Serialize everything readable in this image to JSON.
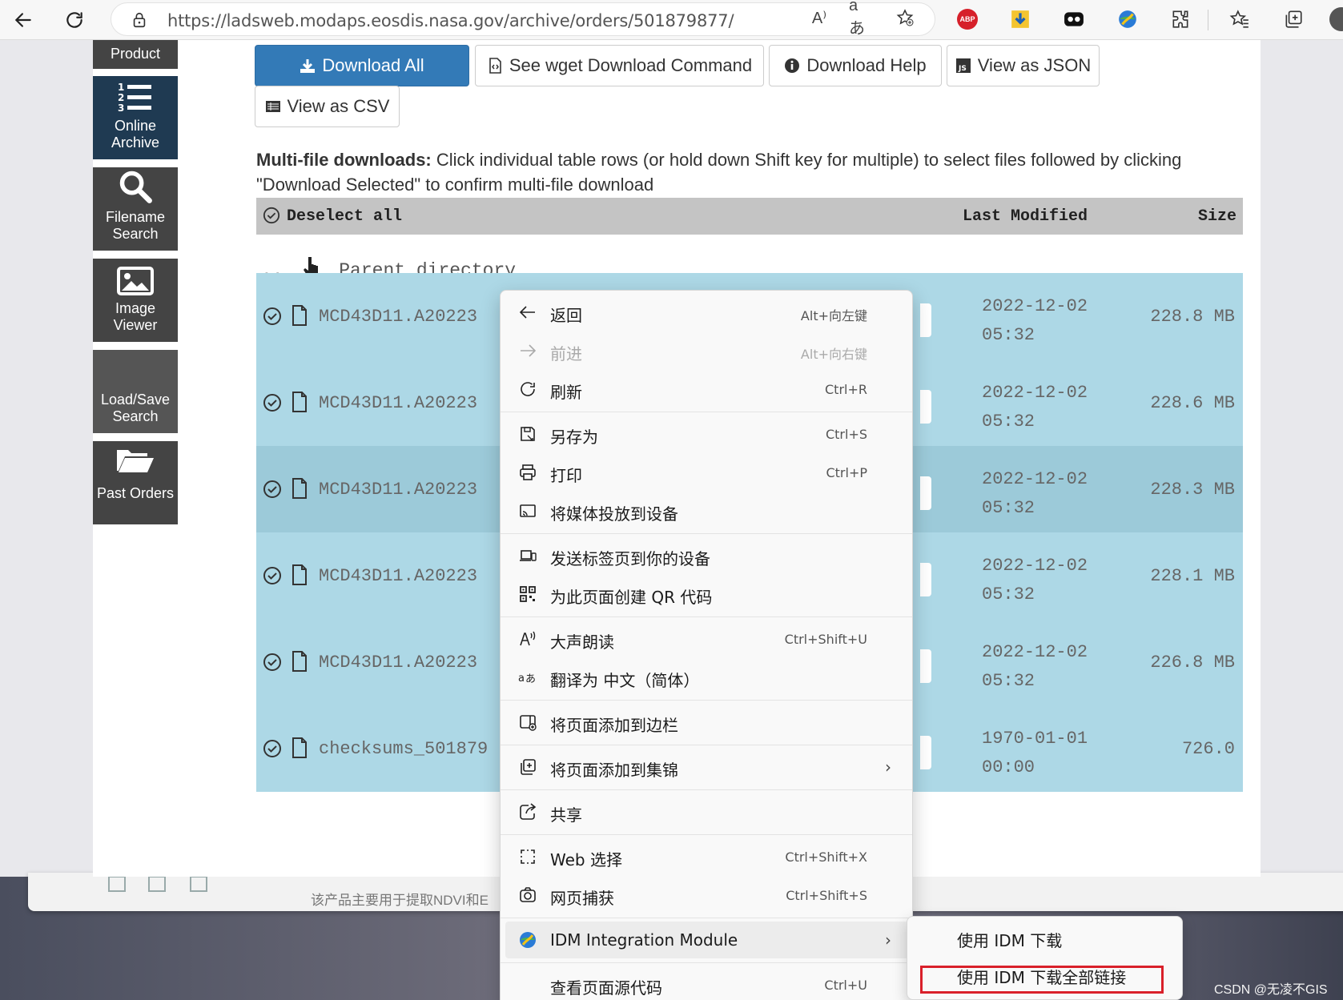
{
  "browser": {
    "url": "https://ladsweb.modaps.eosdis.nasa.gov/archive/orders/501879877/",
    "read_aloud_glyph": "A⁾",
    "translate_glyph": "aあ",
    "abp_label": "ABP"
  },
  "sidebar": {
    "items": [
      {
        "label_1": "Product",
        "label_2": ""
      },
      {
        "label_1": "Online",
        "label_2": "Archive"
      },
      {
        "label_1": "Filename",
        "label_2": "Search"
      },
      {
        "label_1": "Image",
        "label_2": "Viewer"
      },
      {
        "label_1": "Load/Save",
        "label_2": "Search"
      },
      {
        "label_1": "Past Orders",
        "label_2": ""
      }
    ]
  },
  "actions": {
    "download_all": "Download All",
    "wget": "See wget Download Command",
    "help": "Download Help",
    "json": "View as JSON",
    "csv": "View as CSV"
  },
  "info": {
    "bold": "Multi-file downloads:",
    "text": " Click individual table rows (or hold down Shift key for multiple) to select files followed by clicking \"Download Selected\" to confirm multi-file download"
  },
  "table": {
    "deselect_all": "Deselect all",
    "col_modified": "Last Modified",
    "col_size": "Size",
    "parent_dots": "..",
    "parent_label": "Parent directory",
    "rows": [
      {
        "name": "MCD43D11.A20223",
        "date": "2022-12-02",
        "time": "05:32",
        "size": "228.8 MB"
      },
      {
        "name": "MCD43D11.A20223",
        "date": "2022-12-02",
        "time": "05:32",
        "size": "228.6 MB"
      },
      {
        "name": "MCD43D11.A20223",
        "date": "2022-12-02",
        "time": "05:32",
        "size": "228.3 MB"
      },
      {
        "name": "MCD43D11.A20223",
        "date": "2022-12-02",
        "time": "05:32",
        "size": "228.1 MB"
      },
      {
        "name": "MCD43D11.A20223",
        "date": "2022-12-02",
        "time": "05:32",
        "size": "226.8 MB"
      },
      {
        "name": "checksums_501879",
        "date": "1970-01-01",
        "time": "00:00",
        "size": "726.0"
      }
    ]
  },
  "context_menu": {
    "back": {
      "label": "返回",
      "shortcut": "Alt+向左键"
    },
    "forward": {
      "label": "前进",
      "shortcut": "Alt+向右键"
    },
    "refresh": {
      "label": "刷新",
      "shortcut": "Ctrl+R"
    },
    "save_as": {
      "label": "另存为",
      "shortcut": "Ctrl+S"
    },
    "print": {
      "label": "打印",
      "shortcut": "Ctrl+P"
    },
    "cast": {
      "label": "将媒体投放到设备"
    },
    "send_tab": {
      "label": "发送标签页到你的设备"
    },
    "qr": {
      "label": "为此页面创建 QR 代码"
    },
    "read_aloud": {
      "label": "大声朗读",
      "shortcut": "Ctrl+Shift+U"
    },
    "translate": {
      "label": "翻译为 中文（简体）"
    },
    "sidebar": {
      "label": "将页面添加到边栏"
    },
    "collections": {
      "label": "将页面添加到集锦"
    },
    "share": {
      "label": "共享"
    },
    "web_select": {
      "label": "Web 选择",
      "shortcut": "Ctrl+Shift+X"
    },
    "capture": {
      "label": "网页捕获",
      "shortcut": "Ctrl+Shift+S"
    },
    "idm": {
      "label": "IDM Integration Module"
    },
    "view_source": {
      "label": "查看页面源代码",
      "shortcut": "Ctrl+U"
    }
  },
  "submenu": {
    "download_with_idm": "使用 IDM 下载",
    "download_all_links": "使用 IDM 下载全部链接"
  },
  "background": {
    "text": "该产品主要用于提取NDVI和E"
  },
  "watermark": "CSDN @无凌不GIS",
  "colors": {
    "row_selected": "#add8e6",
    "row_hover": "#9ccad9",
    "primary_button": "#337ab7",
    "sidebar_active": "#1f3a52",
    "sidebar": "#444444",
    "highlight_box": "#d9202a"
  }
}
